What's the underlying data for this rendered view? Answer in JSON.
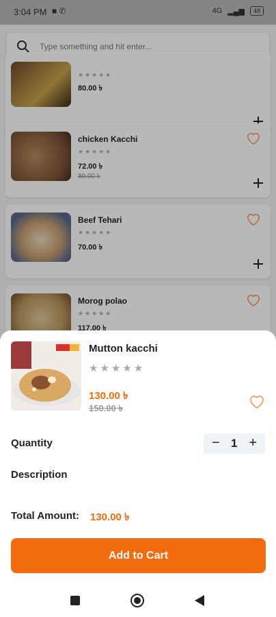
{
  "status_bar": {
    "time": "3:04 PM",
    "network": "4G",
    "battery": "48"
  },
  "search": {
    "placeholder": "Type something and hit enter..."
  },
  "list": [
    {
      "name": "",
      "stars": "★★★★★",
      "price": "80.00 ৳",
      "old_price": ""
    },
    {
      "name": "chicken Kacchi",
      "stars": "★★★★★",
      "price": "72.00 ৳",
      "old_price": "80.00 ৳"
    },
    {
      "name": "Beef Tehari",
      "stars": "★★★★★",
      "price": "70.00 ৳",
      "old_price": ""
    },
    {
      "name": "Morog polao",
      "stars": "★★★★★",
      "price": "117.00 ৳",
      "old_price": ""
    }
  ],
  "product": {
    "name": "Mutton kacchi",
    "stars": "★★★★★",
    "price": "130.00 ৳",
    "old_price": "150.00 ৳",
    "quantity_label": "Quantity",
    "quantity": "1",
    "description_label": "Description",
    "total_label": "Total Amount:",
    "total_value": "130.00 ৳",
    "add_to_cart": "Add to Cart"
  },
  "icons": {
    "search": "search-icon",
    "heart": "heart-outline-icon",
    "plus": "plus-icon",
    "minus": "minus-icon",
    "nav_recent": "square-icon",
    "nav_home": "circle-icon",
    "nav_back": "triangle-back-icon"
  },
  "colors": {
    "accent": "#f26b0f",
    "stepper_bg": "#eef3f8"
  }
}
